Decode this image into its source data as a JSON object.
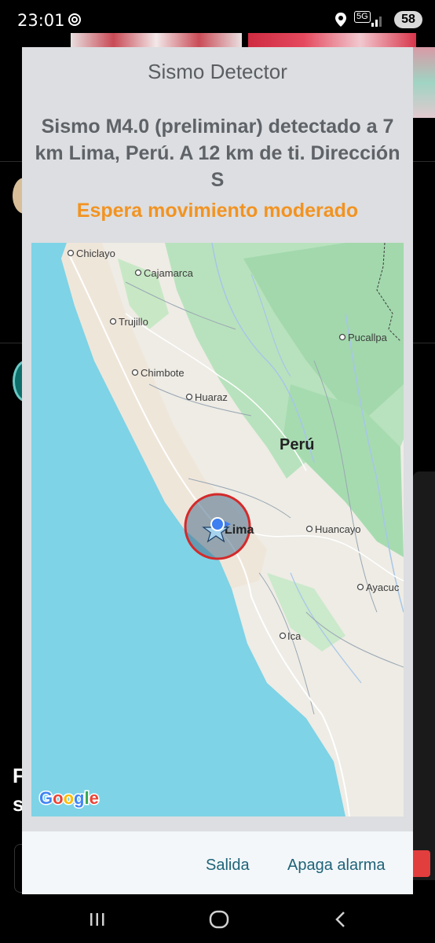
{
  "status_bar": {
    "time": "23:01",
    "network": "5G",
    "battery": "58"
  },
  "dialog": {
    "title": "Sismo Detector",
    "message": "Sismo M4.0 (preliminar) detectado a 7 km Lima, Perú. A 12 km de ti. Dirección S",
    "warning": "Espera movimiento moderado",
    "warning_color": "#f29321",
    "buttons": {
      "exit": "Salida",
      "stop_alarm": "Apaga alarma"
    }
  },
  "map": {
    "country_label": "Perú",
    "cities": [
      "Chiclayo",
      "Cajamarca",
      "Trujillo",
      "Pucallpa",
      "Chimbote",
      "Huaraz",
      "Lima",
      "Huancayo",
      "Ayacuc",
      "Ica"
    ],
    "attribution": "Google",
    "epicenter_icon": "star-icon",
    "user_location_icon": "location-dot-icon"
  },
  "background": {
    "letters": [
      "F",
      "s"
    ]
  }
}
